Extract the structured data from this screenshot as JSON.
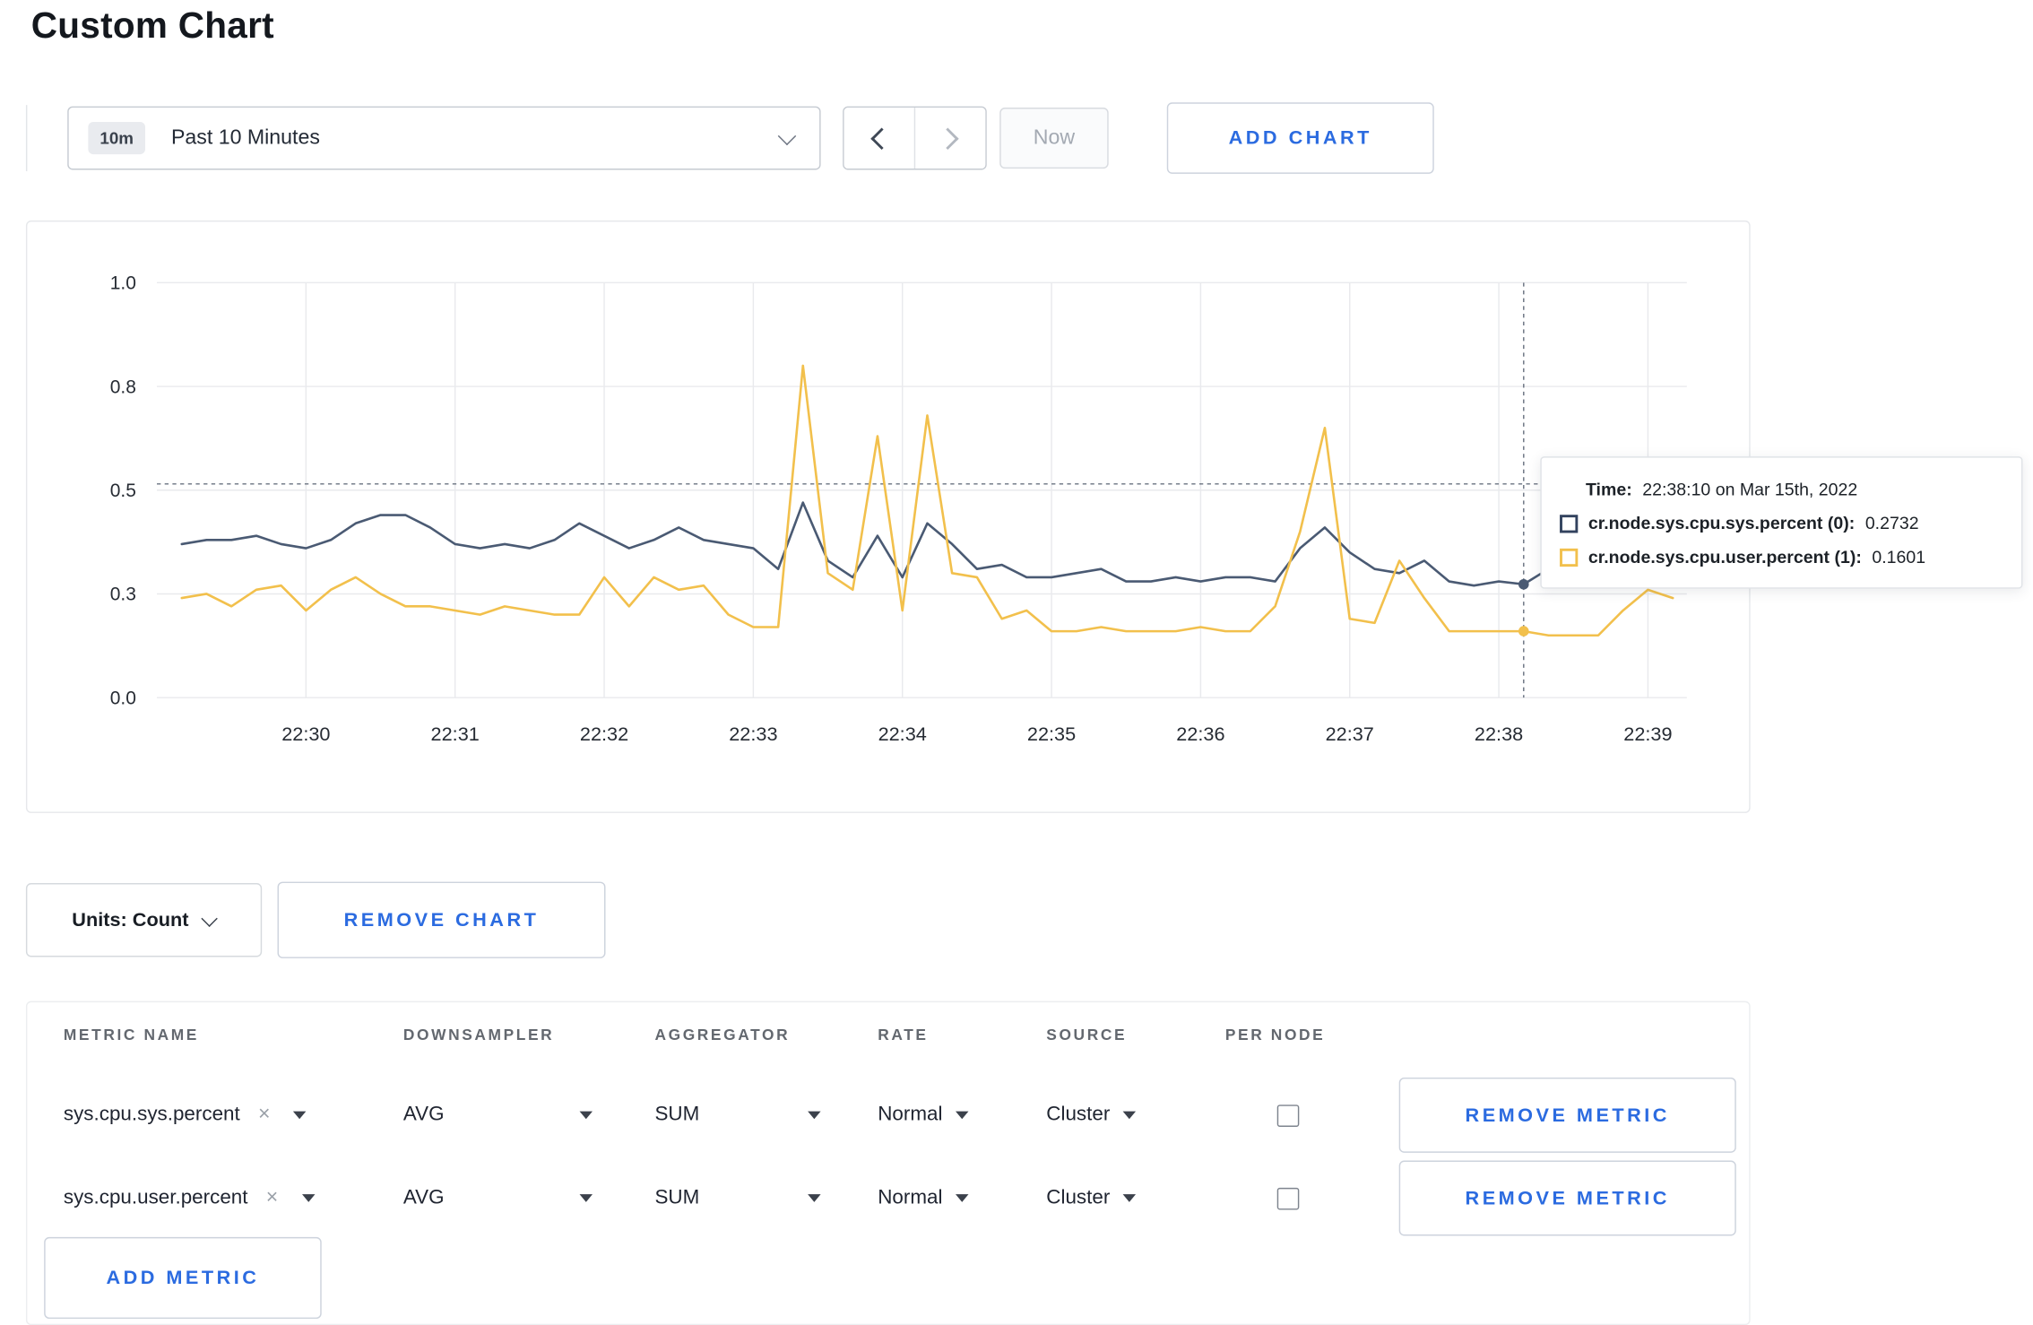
{
  "page": {
    "title": "Custom Chart"
  },
  "toolbar": {
    "time_range": {
      "badge": "10m",
      "label": "Past 10 Minutes"
    },
    "now_label": "Now",
    "add_chart_label": "ADD CHART",
    "icons": {
      "time_range_caret": "chevron-down",
      "prev": "chevron-left",
      "next": "chevron-right"
    }
  },
  "chart_data": {
    "type": "line",
    "title": "",
    "xlabel": "",
    "ylabel": "",
    "ylim": [
      0,
      1
    ],
    "grid": true,
    "legend_position": "none",
    "x_start": "22:29:10",
    "x_interval_seconds": 10,
    "x_ticks": [
      "22:30",
      "22:31",
      "22:32",
      "22:33",
      "22:34",
      "22:35",
      "22:36",
      "22:37",
      "22:38",
      "22:39"
    ],
    "y_ticks": [
      {
        "value": 1.0,
        "label": "1.0"
      },
      {
        "value": 0.75,
        "label": "0.8"
      },
      {
        "value": 0.5,
        "label": "0.5"
      },
      {
        "value": 0.25,
        "label": "0.3"
      },
      {
        "value": 0.0,
        "label": "0.0"
      }
    ],
    "series": [
      {
        "name": "cr.node.sys.cpu.sys.percent",
        "color": "#4a5a73",
        "values": [
          0.37,
          0.38,
          0.38,
          0.39,
          0.37,
          0.36,
          0.38,
          0.42,
          0.44,
          0.44,
          0.41,
          0.37,
          0.36,
          0.37,
          0.36,
          0.38,
          0.42,
          0.39,
          0.36,
          0.38,
          0.41,
          0.38,
          0.37,
          0.36,
          0.31,
          0.47,
          0.33,
          0.29,
          0.39,
          0.29,
          0.42,
          0.37,
          0.31,
          0.32,
          0.29,
          0.29,
          0.3,
          0.31,
          0.28,
          0.28,
          0.29,
          0.28,
          0.29,
          0.29,
          0.28,
          0.36,
          0.41,
          0.35,
          0.31,
          0.3,
          0.33,
          0.28,
          0.27,
          0.28,
          0.2732,
          0.31,
          0.29,
          0.3,
          0.3,
          0.3,
          0.31
        ]
      },
      {
        "name": "cr.node.sys.cpu.user.percent",
        "color": "#f2c04c",
        "values": [
          0.24,
          0.25,
          0.22,
          0.26,
          0.27,
          0.21,
          0.26,
          0.29,
          0.25,
          0.22,
          0.22,
          0.21,
          0.2,
          0.22,
          0.21,
          0.2,
          0.2,
          0.29,
          0.22,
          0.29,
          0.26,
          0.27,
          0.2,
          0.17,
          0.17,
          0.8,
          0.3,
          0.26,
          0.63,
          0.21,
          0.68,
          0.3,
          0.29,
          0.19,
          0.21,
          0.16,
          0.16,
          0.17,
          0.16,
          0.16,
          0.16,
          0.17,
          0.16,
          0.16,
          0.22,
          0.4,
          0.65,
          0.19,
          0.18,
          0.33,
          0.24,
          0.16,
          0.16,
          0.16,
          0.1601,
          0.15,
          0.15,
          0.15,
          0.21,
          0.26,
          0.24
        ]
      }
    ],
    "crosshair": {
      "index": 54,
      "time": "22:38:10",
      "hline_value": 0.515
    }
  },
  "tooltip": {
    "time_label": "Time:",
    "time_value": "22:38:10 on Mar 15th, 2022",
    "rows": [
      {
        "label": "cr.node.sys.cpu.sys.percent (0):",
        "value": "0.2732",
        "color": "#32425e"
      },
      {
        "label": "cr.node.sys.cpu.user.percent (1):",
        "value": "0.1601",
        "color": "#f2c04c"
      }
    ]
  },
  "chart_footer": {
    "units_label": "Units: Count",
    "remove_chart_label": "REMOVE CHART"
  },
  "metrics_table": {
    "headers": [
      "METRIC NAME",
      "DOWNSAMPLER",
      "AGGREGATOR",
      "RATE",
      "SOURCE",
      "PER NODE"
    ],
    "rows": [
      {
        "metric": "sys.cpu.sys.percent",
        "downsampler": "AVG",
        "aggregator": "SUM",
        "rate": "Normal",
        "source": "Cluster",
        "per_node": false,
        "remove_label": "REMOVE METRIC"
      },
      {
        "metric": "sys.cpu.user.percent",
        "downsampler": "AVG",
        "aggregator": "SUM",
        "rate": "Normal",
        "source": "Cluster",
        "per_node": false,
        "remove_label": "REMOVE METRIC"
      }
    ],
    "add_metric_label": "ADD METRIC"
  },
  "colors": {
    "accent_blue": "#2b6be0",
    "series_sys": "#4a5a73",
    "series_user": "#f2c04c",
    "grid": "#e9eaed",
    "crosshair": "#6a7380"
  }
}
